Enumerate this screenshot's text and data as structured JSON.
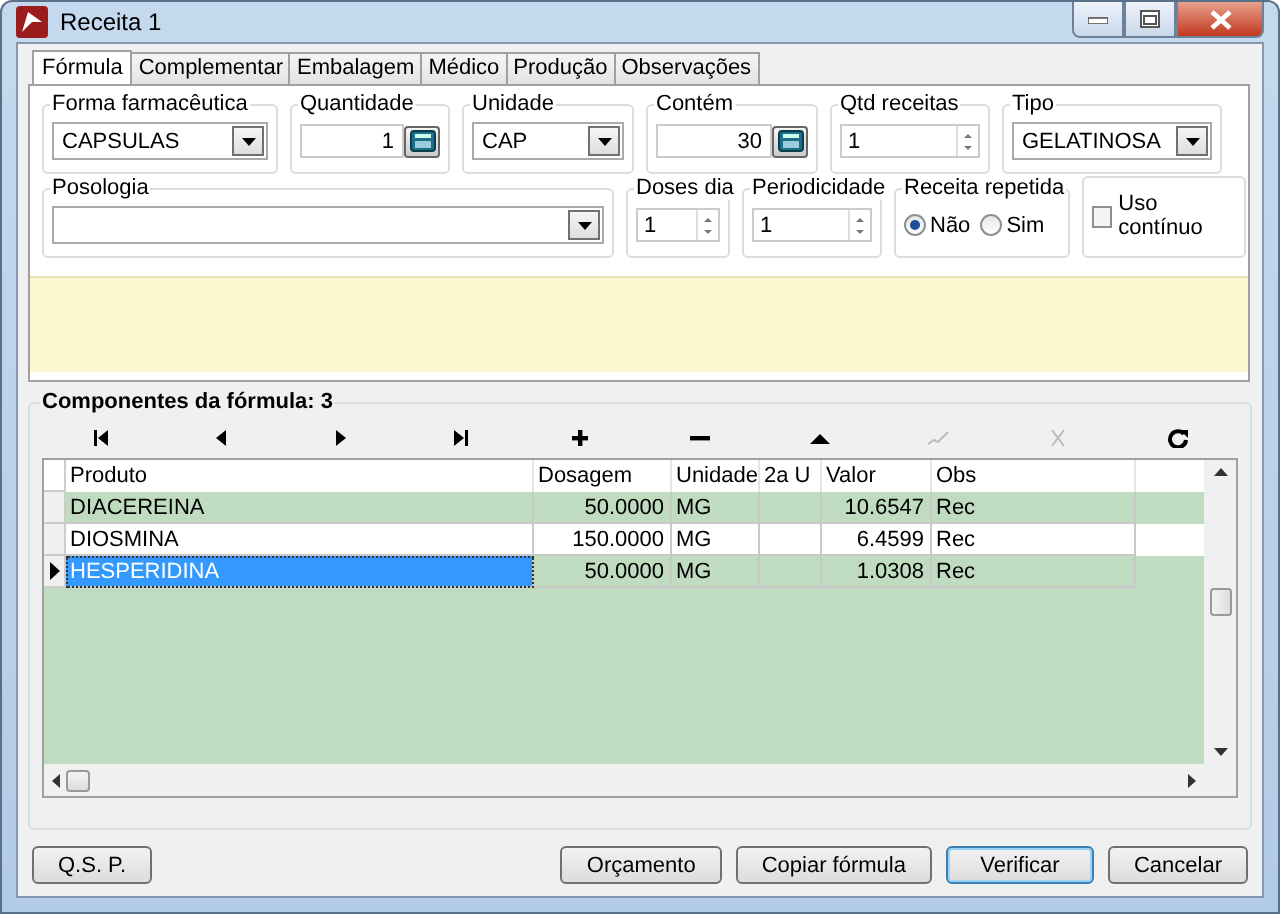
{
  "window": {
    "title": "Receita 1"
  },
  "tabs": [
    {
      "label": "Fórmula",
      "selected": true
    },
    {
      "label": "Complementar",
      "selected": false
    },
    {
      "label": "Embalagem",
      "selected": false
    },
    {
      "label": "Médico",
      "selected": false
    },
    {
      "label": "Produção",
      "selected": false
    },
    {
      "label": "Observações",
      "selected": false
    }
  ],
  "row1": [
    {
      "label": "Forma farmacêutica",
      "kind": "combo",
      "value": "CAPSULAS"
    },
    {
      "label": "Quantidade",
      "kind": "calc",
      "value": "1"
    },
    {
      "label": "Unidade",
      "kind": "combo",
      "value": "CAP"
    },
    {
      "label": "Contém",
      "kind": "calc",
      "value": "30"
    },
    {
      "label": "Qtd receitas",
      "kind": "spin",
      "value": "1"
    },
    {
      "label": "Tipo",
      "kind": "combo",
      "value": "GELATINOSA"
    }
  ],
  "posologia": {
    "label": "Posologia"
  },
  "doses_dia": {
    "label": "Doses dia",
    "value": "1"
  },
  "periodicidade": {
    "label": "Periodicidade",
    "value": "1"
  },
  "receita_repetida": {
    "label": "Receita repetida",
    "options": [
      {
        "label": "Não",
        "selected": true
      },
      {
        "label": "Sim",
        "selected": false
      }
    ]
  },
  "uso_continuo": {
    "label": "Uso contínuo",
    "checked": false
  },
  "components": {
    "title": "Componentes da fórmula: 3",
    "navigator": [
      {
        "kind": "first",
        "disabled": false
      },
      {
        "kind": "prior",
        "disabled": false
      },
      {
        "kind": "next",
        "disabled": false
      },
      {
        "kind": "last",
        "disabled": false
      },
      {
        "kind": "insert",
        "disabled": false
      },
      {
        "kind": "delete",
        "disabled": false
      },
      {
        "kind": "edit",
        "disabled": false
      },
      {
        "kind": "post",
        "disabled": true
      },
      {
        "kind": "cancel",
        "disabled": true
      },
      {
        "kind": "refresh",
        "disabled": false
      }
    ],
    "columns": [
      "Produto",
      "Dosagem",
      "Unidade",
      "2a U",
      "Valor",
      "Obs"
    ],
    "rows": [
      {
        "cells": [
          "DIACEREINA",
          "50.0000",
          "MG",
          "",
          "10.6547",
          "Rec"
        ],
        "selected": false
      },
      {
        "cells": [
          "DIOSMINA",
          "150.0000",
          "MG",
          "",
          "6.4599",
          "Rec"
        ],
        "selected": false
      },
      {
        "cells": [
          "HESPERIDINA",
          "50.0000",
          "MG",
          "",
          "1.0308",
          "Rec"
        ],
        "selected": true
      }
    ]
  },
  "buttons_left": [
    "Q.S. P."
  ],
  "buttons_right": [
    {
      "label": "Orçamento",
      "default": false
    },
    {
      "label": "Copiar fórmula",
      "default": false
    },
    {
      "label": "Verificar",
      "default": true
    },
    {
      "label": "Cancelar",
      "default": false
    }
  ]
}
